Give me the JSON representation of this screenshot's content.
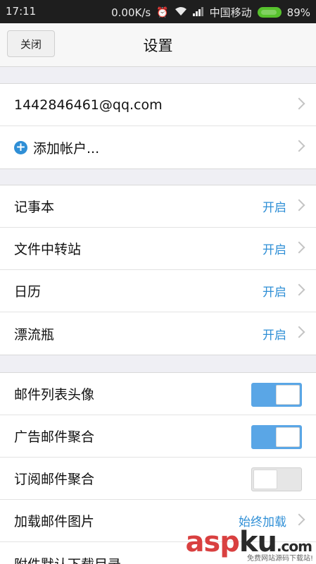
{
  "status_bar": {
    "time": "17:11",
    "speed": "0.00K/s",
    "carrier": "中国移动",
    "battery": "89%"
  },
  "nav": {
    "close_label": "关闭",
    "title": "设置"
  },
  "accounts": {
    "email": "1442846461@qq.com",
    "add_label": "添加帐户..."
  },
  "features": [
    {
      "label": "记事本",
      "value": "开启"
    },
    {
      "label": "文件中转站",
      "value": "开启"
    },
    {
      "label": "日历",
      "value": "开启"
    },
    {
      "label": "漂流瓶",
      "value": "开启"
    }
  ],
  "options": [
    {
      "label": "邮件列表头像",
      "on": true
    },
    {
      "label": "广告邮件聚合",
      "on": true
    },
    {
      "label": "订阅邮件聚合",
      "on": false
    }
  ],
  "more": {
    "load_images_label": "加载邮件图片",
    "load_images_value": "始终加载",
    "attachment_dir_label": "附件默认下载目录"
  },
  "watermark": {
    "asp": "asp",
    "ku": "ku",
    "com": ".com",
    "sub": "免费网站源码下载站!"
  },
  "colors": {
    "accent": "#2f8fd6",
    "toggle_on": "#5aa6e6",
    "battery": "#57c22d"
  }
}
